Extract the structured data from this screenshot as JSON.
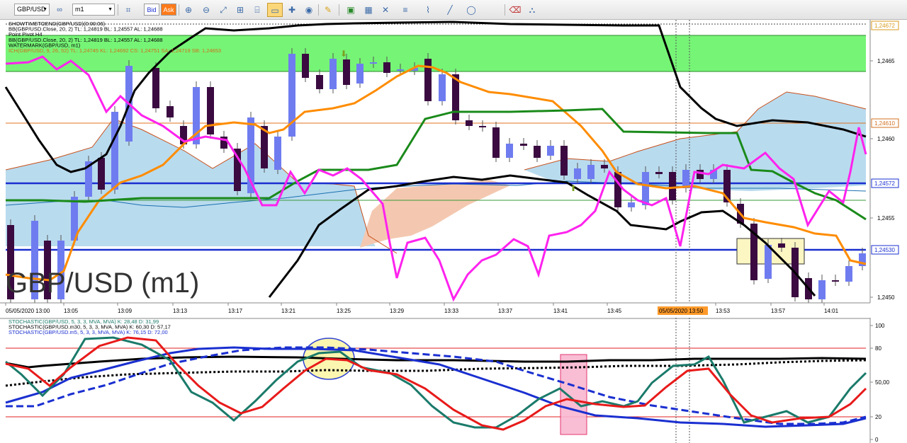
{
  "toolbar": {
    "symbol": "GBP/USD",
    "timeframe": "m1",
    "bid_label": "Bid",
    "ask_label": "Ask",
    "icons": [
      "chain-icon",
      "chart-type-icon",
      "zoom-in-icon",
      "zoom-out-icon",
      "fit-icon",
      "cursor-icon",
      "crosshair-icon",
      "pencil-icon",
      "template-icon",
      "indicator-icon",
      "line-tool-icon",
      "fibonacci-icon",
      "text-icon",
      "shape-icon",
      "eraser-icon",
      "layers-icon"
    ]
  },
  "main": {
    "watermark": "GBP/USD (m1)",
    "legend": [
      {
        "text": "SHOWTIMETOEND(GBP/USD)(0:00:06)",
        "color": "#000000"
      },
      {
        "text": "BB(GBP/USD.Close, 20, 2)  TL: 1,24819  BL: 1,24557  AL: 1,24688",
        "color": "#000000"
      },
      {
        "text": "Point Pivot H4",
        "color": "#000000"
      },
      {
        "text": "BB(GBP/USD.Close, 20, 2)  TL: 1,24819  BL: 1,24557  AL: 1,24688",
        "color": "#000000"
      },
      {
        "text": "WATERMARK(GBP/USD, m1)",
        "color": "#000000"
      },
      {
        "text": "ICH(GBP/USD, 9, 26, 52)  TL: 1,24745  KL: 1,24692  CS: 1,24751  SA: 1,24719  SB: 1,24653",
        "color": "#d0701a"
      }
    ],
    "y_labels": [
      "1,2465",
      "1,2460",
      "1,2455",
      "1,2450"
    ],
    "price_tags": [
      {
        "text": "1,24672",
        "color": "#d99a1c"
      },
      {
        "text": "1,24610",
        "color": "#d07020"
      },
      {
        "text": "1,24572",
        "color": "#1a2fd0"
      },
      {
        "text": "1,24530",
        "color": "#1a2fd0"
      }
    ],
    "x_labels": [
      "05/05/2020 13:00",
      "13:05",
      "13:09",
      "13:13",
      "13:17",
      "13:21",
      "13:25",
      "13:29",
      "13:33",
      "13:37",
      "13:41",
      "13:45",
      "13:53",
      "13:57",
      "14:01"
    ],
    "cursor_time": "05/05/2020 13:50",
    "colors": {
      "bull": "#6f7cf0",
      "bear": "#3a0a40",
      "pivot_zone": "#5ef25e",
      "cloud_blue": "#b9dbee",
      "cloud_orange": "#f4c8b0",
      "bb_band": "#000000",
      "bb_mid": "#ff8c00",
      "tenkan": "#ff22ee",
      "kijun": "#1a8a1a",
      "levels": "#1a2fd0"
    }
  },
  "stoch": {
    "legend": [
      {
        "text": "STOCHASTIC(GBP/USD, 5, 3, 3, MVA, MVA)  K: 28,48  D: 31,99",
        "color": "#1a7a6a"
      },
      {
        "text": "STOCHASTIC(GBP/USD.m30, 5, 3, 3, MVA, MVA)  K: 60,30  D: 57,17",
        "color": "#000000"
      },
      {
        "text": "STOCHASTIC(GBP/USD.m5, 5, 3, 3, MVA, MVA)  K: 76,15  D: 72,00",
        "color": "#1a2fd0"
      }
    ],
    "y_labels": [
      "100",
      "80",
      "50,00",
      "20",
      "0"
    ],
    "levels": [
      80,
      20
    ]
  }
}
